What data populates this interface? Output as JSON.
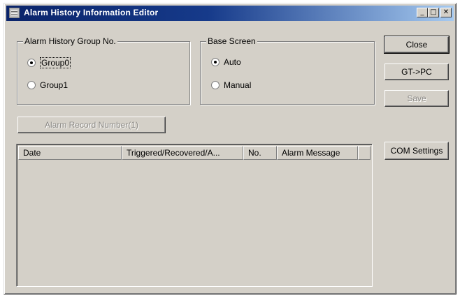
{
  "window": {
    "title": "Alarm History Information Editor"
  },
  "title_buttons": {
    "minimize": "_",
    "maximize": "□",
    "close": "✕"
  },
  "alarm_group": {
    "title": "Alarm History Group No.",
    "options": [
      {
        "label": "Group0",
        "checked": true
      },
      {
        "label": "Group1",
        "checked": false
      }
    ]
  },
  "base_screen": {
    "title": "Base Screen",
    "options": [
      {
        "label": "Auto",
        "checked": true
      },
      {
        "label": "Manual",
        "checked": false
      }
    ]
  },
  "buttons": {
    "close": "Close",
    "gt_pc": "GT->PC",
    "save": "Save",
    "com_settings": "COM Settings",
    "alarm_record_number": "Alarm Record Number(1)"
  },
  "table": {
    "columns": [
      "Date",
      "Triggered/Recovered/A...",
      "No.",
      "Alarm Message"
    ],
    "rows": []
  }
}
